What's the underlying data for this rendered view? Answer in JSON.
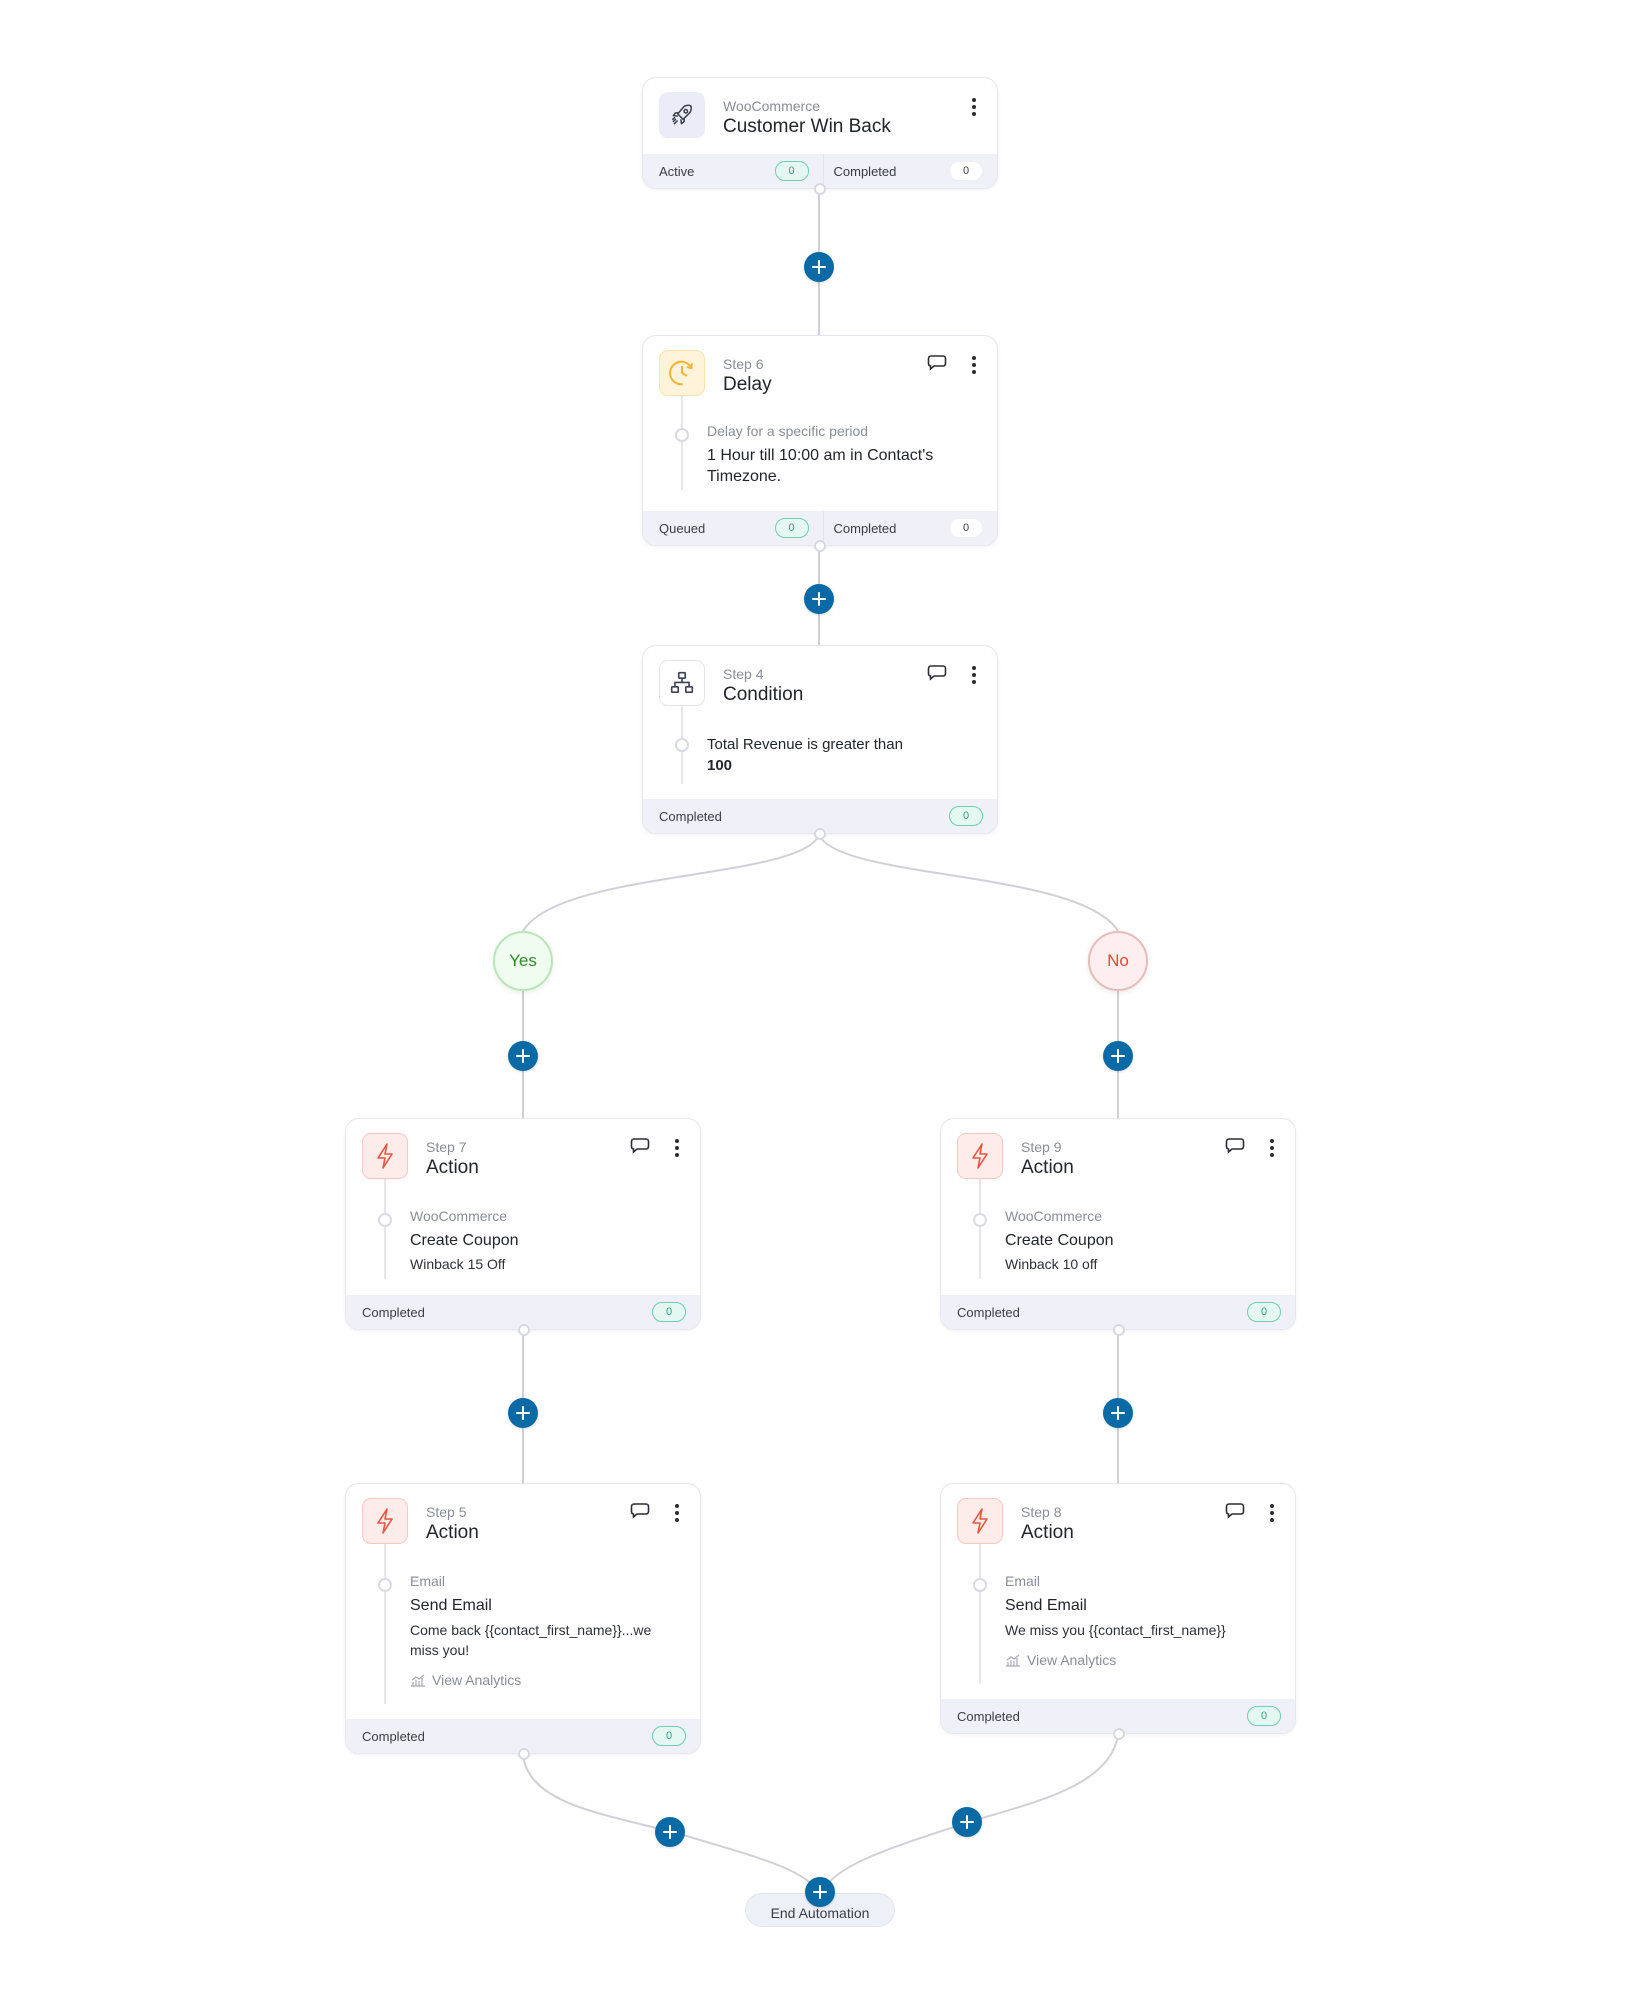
{
  "trigger": {
    "category": "WooCommerce",
    "title": "Customer Win Back",
    "icon": "rocket-icon",
    "stats": [
      {
        "label": "Active",
        "count": "0",
        "style": "green"
      },
      {
        "label": "Completed",
        "count": "0",
        "style": "white"
      }
    ]
  },
  "steps": {
    "delay": {
      "step": "Step 6",
      "title": "Delay",
      "icon": "clock-icon",
      "label": "Delay for a specific period",
      "text": "1 Hour till 10:00 am in Contact's Timezone.",
      "stats": [
        {
          "label": "Queued",
          "count": "0",
          "style": "green"
        },
        {
          "label": "Completed",
          "count": "0",
          "style": "white"
        }
      ]
    },
    "condition": {
      "step": "Step 4",
      "title": "Condition",
      "icon": "sitemap-icon",
      "text": "Total Revenue is greater than",
      "value": "100",
      "stats": [
        {
          "label": "Completed",
          "count": "0",
          "style": "green"
        }
      ]
    },
    "step7": {
      "step": "Step 7",
      "title": "Action",
      "icon": "lightning-icon",
      "label": "WooCommerce",
      "main": "Create Coupon",
      "detail": "Winback 15 Off",
      "stats": [
        {
          "label": "Completed",
          "count": "0",
          "style": "green"
        }
      ]
    },
    "step9": {
      "step": "Step 9",
      "title": "Action",
      "icon": "lightning-icon",
      "label": "WooCommerce",
      "main": "Create Coupon",
      "detail": "Winback 10 off",
      "stats": [
        {
          "label": "Completed",
          "count": "0",
          "style": "green"
        }
      ]
    },
    "step5": {
      "step": "Step 5",
      "title": "Action",
      "icon": "lightning-icon",
      "label": "Email",
      "main": "Send Email",
      "detail": "Come back {{contact_first_name}}...we miss you!",
      "analytics": "View Analytics",
      "stats": [
        {
          "label": "Completed",
          "count": "0",
          "style": "green"
        }
      ]
    },
    "step8": {
      "step": "Step 8",
      "title": "Action",
      "icon": "lightning-icon",
      "label": "Email",
      "main": "Send Email",
      "detail": "We miss you {{contact_first_name}}",
      "analytics": "View Analytics",
      "stats": [
        {
          "label": "Completed",
          "count": "0",
          "style": "green"
        }
      ]
    }
  },
  "branches": {
    "yes": "Yes",
    "no": "No"
  },
  "end": {
    "label": "End Automation"
  },
  "colors": {
    "add_button": "#0a6aa6",
    "yes": "#2f8a2c",
    "no": "#dd4a35",
    "action_icon": "#e8553f",
    "delay_icon": "#f5b532",
    "badge_green": "#2ea084"
  }
}
